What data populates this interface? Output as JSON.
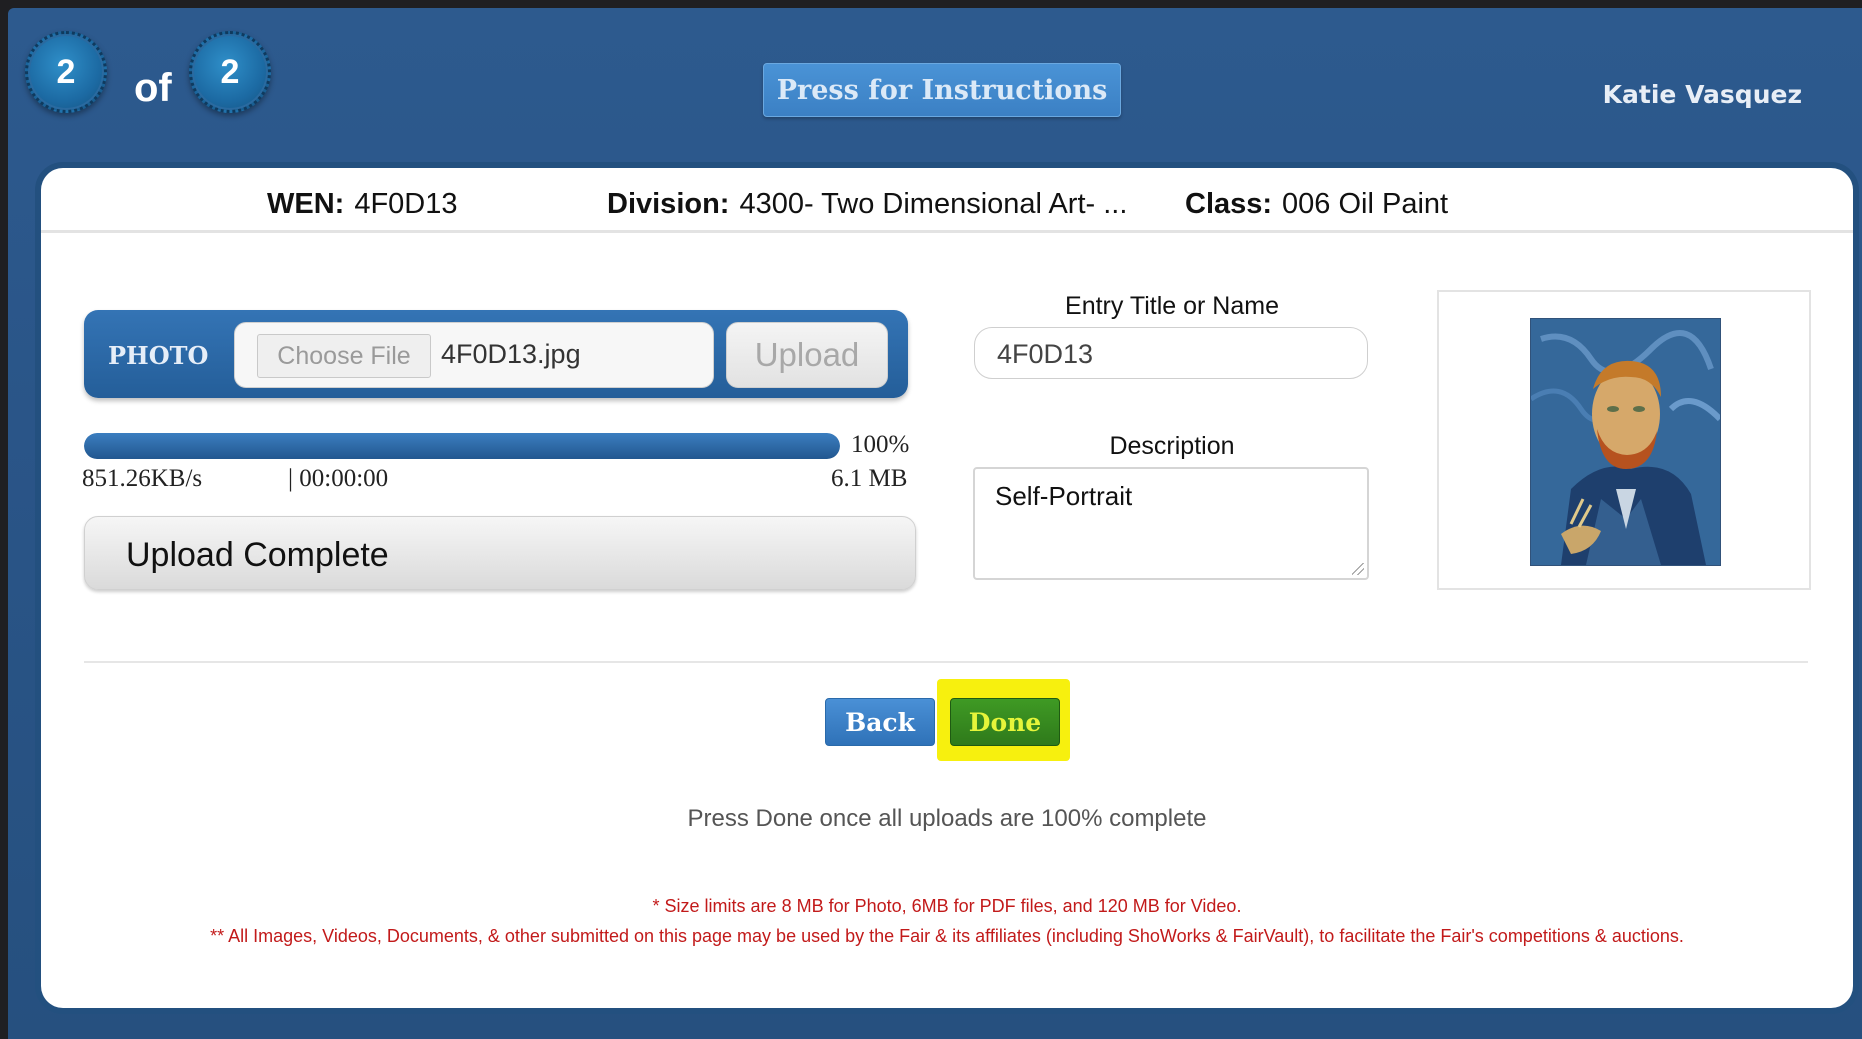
{
  "header": {
    "current_step": "2",
    "of_label": "of",
    "total_steps": "2",
    "instructions_button": "Press for Instructions",
    "user_name": "Katie Vasquez"
  },
  "entry_info": {
    "wen_label": "WEN:",
    "wen_value": "4F0D13",
    "division_label": "Division:",
    "division_value": "4300- Two Dimensional Art- ...",
    "class_label": "Class:",
    "class_value": "006 Oil Paint"
  },
  "photo_upload": {
    "label": "PHOTO",
    "choose_file_label": "Choose File",
    "file_name": "4F0D13.jpg",
    "upload_button": "Upload",
    "progress_percent": 100,
    "progress_text": "100%",
    "speed": "851.26KB/s",
    "elapsed": "| 00:00:00",
    "file_size": "6.1 MB",
    "status": "Upload Complete"
  },
  "form": {
    "title_label": "Entry Title or Name",
    "title_value": "4F0D13",
    "description_label": "Description",
    "description_value": "Self-Portrait"
  },
  "actions": {
    "back_label": "Back",
    "done_label": "Done"
  },
  "notes": {
    "instruction": "Press Done once all uploads are 100% complete",
    "size_limits": "* Size limits are 8 MB for Photo, 6MB for PDF files, and 120 MB for Video.",
    "usage_rights": "** All Images, Videos, Documents, & other submitted on this page may be used by the Fair & its affiliates (including ShoWorks & FairVault), to facilitate the Fair's competitions & auctions."
  },
  "colors": {
    "background_blue": "#2a5588",
    "highlight": "#f7f00e",
    "done_green": "#2f7a1b",
    "back_blue": "#3b80c4",
    "fine_print_red": "#c21a1a"
  }
}
